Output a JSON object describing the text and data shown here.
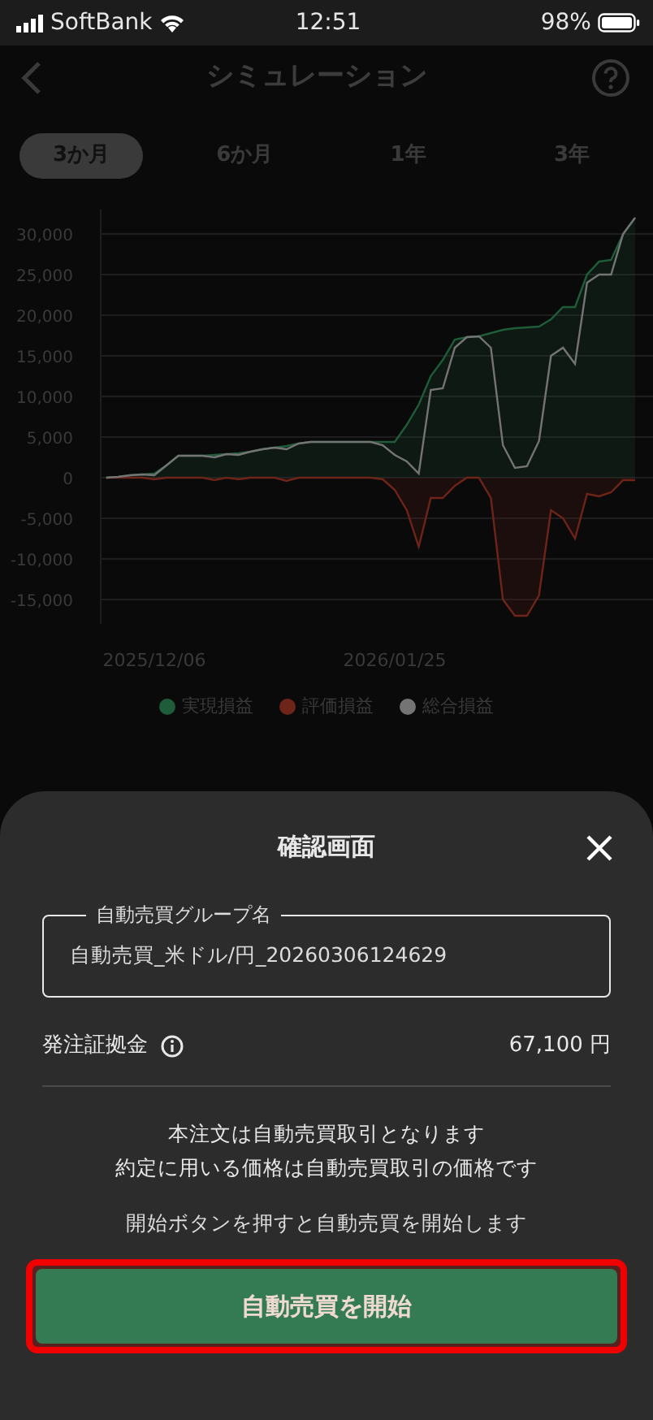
{
  "status_bar": {
    "carrier": "SoftBank",
    "time": "12:51",
    "battery": "98%"
  },
  "header": {
    "title": "シミュレーション"
  },
  "tabs": [
    {
      "label": "3か月",
      "selected": true
    },
    {
      "label": "6か月",
      "selected": false
    },
    {
      "label": "1年",
      "selected": false
    },
    {
      "label": "3年",
      "selected": false
    }
  ],
  "chart": {
    "chart_data": {
      "type": "line",
      "categories": [
        null,
        null,
        null,
        null,
        "2025/12/06",
        null,
        null,
        null,
        null,
        null,
        null,
        null,
        null,
        null,
        null,
        null,
        null,
        null,
        null,
        null,
        null,
        null,
        null,
        null,
        "2026/01/25",
        null,
        null,
        null,
        null,
        null,
        null,
        null,
        null,
        null,
        null,
        null,
        null,
        null,
        null,
        null,
        null,
        null,
        null,
        null,
        null
      ],
      "ylim": [
        -18000,
        33000
      ],
      "grid": true,
      "yticks": [
        {
          "value": 30000,
          "label": "30,000"
        },
        {
          "value": 25000,
          "label": "25,000"
        },
        {
          "value": 20000,
          "label": "20,000"
        },
        {
          "value": 15000,
          "label": "15,000"
        },
        {
          "value": 10000,
          "label": "10,000"
        },
        {
          "value": 5000,
          "label": "5,000"
        },
        {
          "value": 0,
          "label": "0"
        },
        {
          "value": -5000,
          "label": "-5,000"
        },
        {
          "value": -10000,
          "label": "-10,000"
        },
        {
          "value": -15000,
          "label": "-15,000"
        }
      ],
      "series": [
        {
          "name": "実現損益",
          "color": "#1e5c3a",
          "values": [
            0,
            100,
            300,
            400,
            500,
            1500,
            2700,
            2700,
            2700,
            2800,
            2900,
            3000,
            3200,
            3500,
            3700,
            3900,
            4200,
            4400,
            4400,
            4400,
            4400,
            4400,
            4400,
            4400,
            4400,
            6500,
            9000,
            12500,
            14500,
            17000,
            17300,
            17400,
            17800,
            18200,
            18400,
            18500,
            18600,
            19500,
            21000,
            21000,
            25000,
            26600,
            26800,
            30000,
            32000
          ]
        },
        {
          "name": "評価損益",
          "color": "#6e2418",
          "values": [
            0,
            0,
            0,
            0,
            -200,
            0,
            0,
            0,
            0,
            -300,
            0,
            -200,
            0,
            0,
            0,
            -400,
            0,
            0,
            0,
            0,
            0,
            0,
            0,
            -200,
            -1500,
            -4000,
            -8500,
            -2500,
            -2500,
            -1000,
            0,
            0,
            -2500,
            -15000,
            -17000,
            -17000,
            -14500,
            -4000,
            -5000,
            -7500,
            -2000,
            -2300,
            -1800,
            -300,
            -300
          ]
        },
        {
          "name": "総合損益",
          "color": "#747474",
          "values": [
            0,
            100,
            300,
            400,
            300,
            1500,
            2700,
            2700,
            2700,
            2500,
            2900,
            2800,
            3200,
            3500,
            3700,
            3500,
            4200,
            4400,
            4400,
            4400,
            4400,
            4400,
            4400,
            4000,
            2800,
            2000,
            500,
            10800,
            11000,
            16000,
            17300,
            17400,
            16000,
            4000,
            1200,
            1400,
            4500,
            15000,
            16000,
            14000,
            24000,
            25000,
            25000,
            30000,
            32000
          ]
        }
      ]
    }
  },
  "sheet": {
    "title": "確認画面",
    "field": {
      "label": "自動売買グループ名",
      "value": "自動売買_米ドル/円_20260306124629"
    },
    "margin": {
      "label": "発注証拠金",
      "value": "67,100 円"
    },
    "notice": [
      "本注文は自動売買取引となります",
      "約定に用いる価格は自動売買取引の価格です"
    ],
    "hint": "開始ボタンを押すと自動売買を開始します",
    "button": {
      "label": "自動売買を開始",
      "highlighted": true
    }
  }
}
